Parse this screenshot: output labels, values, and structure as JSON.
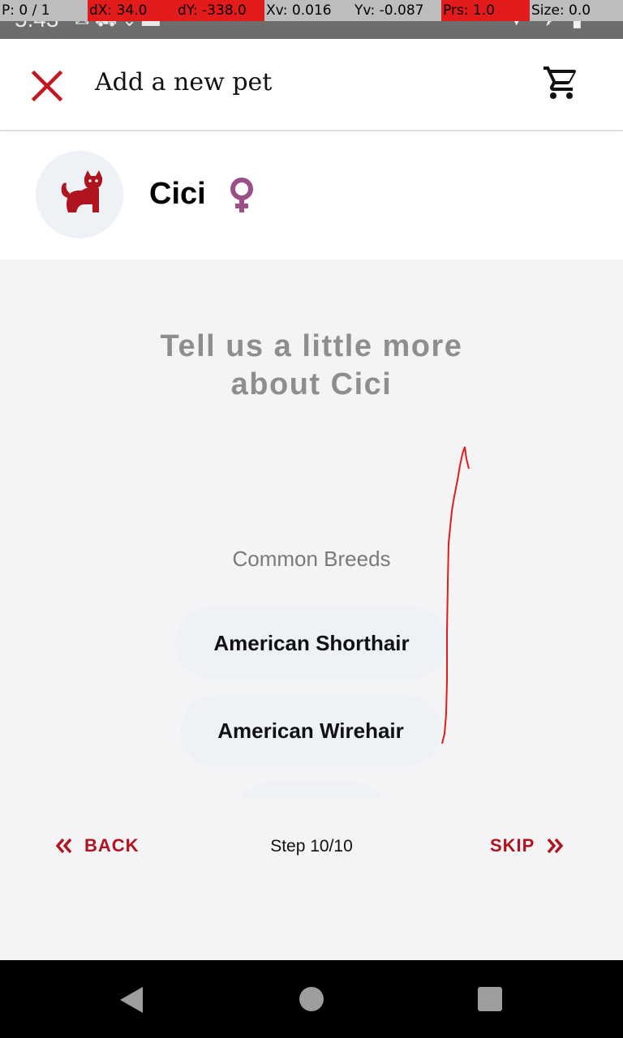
{
  "status_bar": {
    "time": "5:43",
    "debug": {
      "pointer": "P: 0 / 1",
      "dx": "dX: 34.0",
      "dy": "dY: -338.0",
      "xv": "Xv: 0.016",
      "yv": "Yv: -0.087",
      "prs": "Prs: 1.0",
      "size": "Size: 0.0"
    }
  },
  "app_bar": {
    "title": "Add a new pet",
    "close_icon": "close-icon",
    "cart_icon": "cart-icon",
    "accent_color": "#c3161e"
  },
  "pet": {
    "name": "Cici",
    "gender_icon": "female-icon",
    "gender_color": "#9b4f86",
    "avatar_icon": "cat-icon"
  },
  "content": {
    "headline_line1": "Tell us a little more",
    "headline_line2": "about Cici",
    "section_label": "Common Breeds",
    "breeds": [
      "American Shorthair",
      "American Wirehair"
    ]
  },
  "footer": {
    "back_label": "BACK",
    "skip_label": "SKIP",
    "step_text": "Step 10/10"
  }
}
